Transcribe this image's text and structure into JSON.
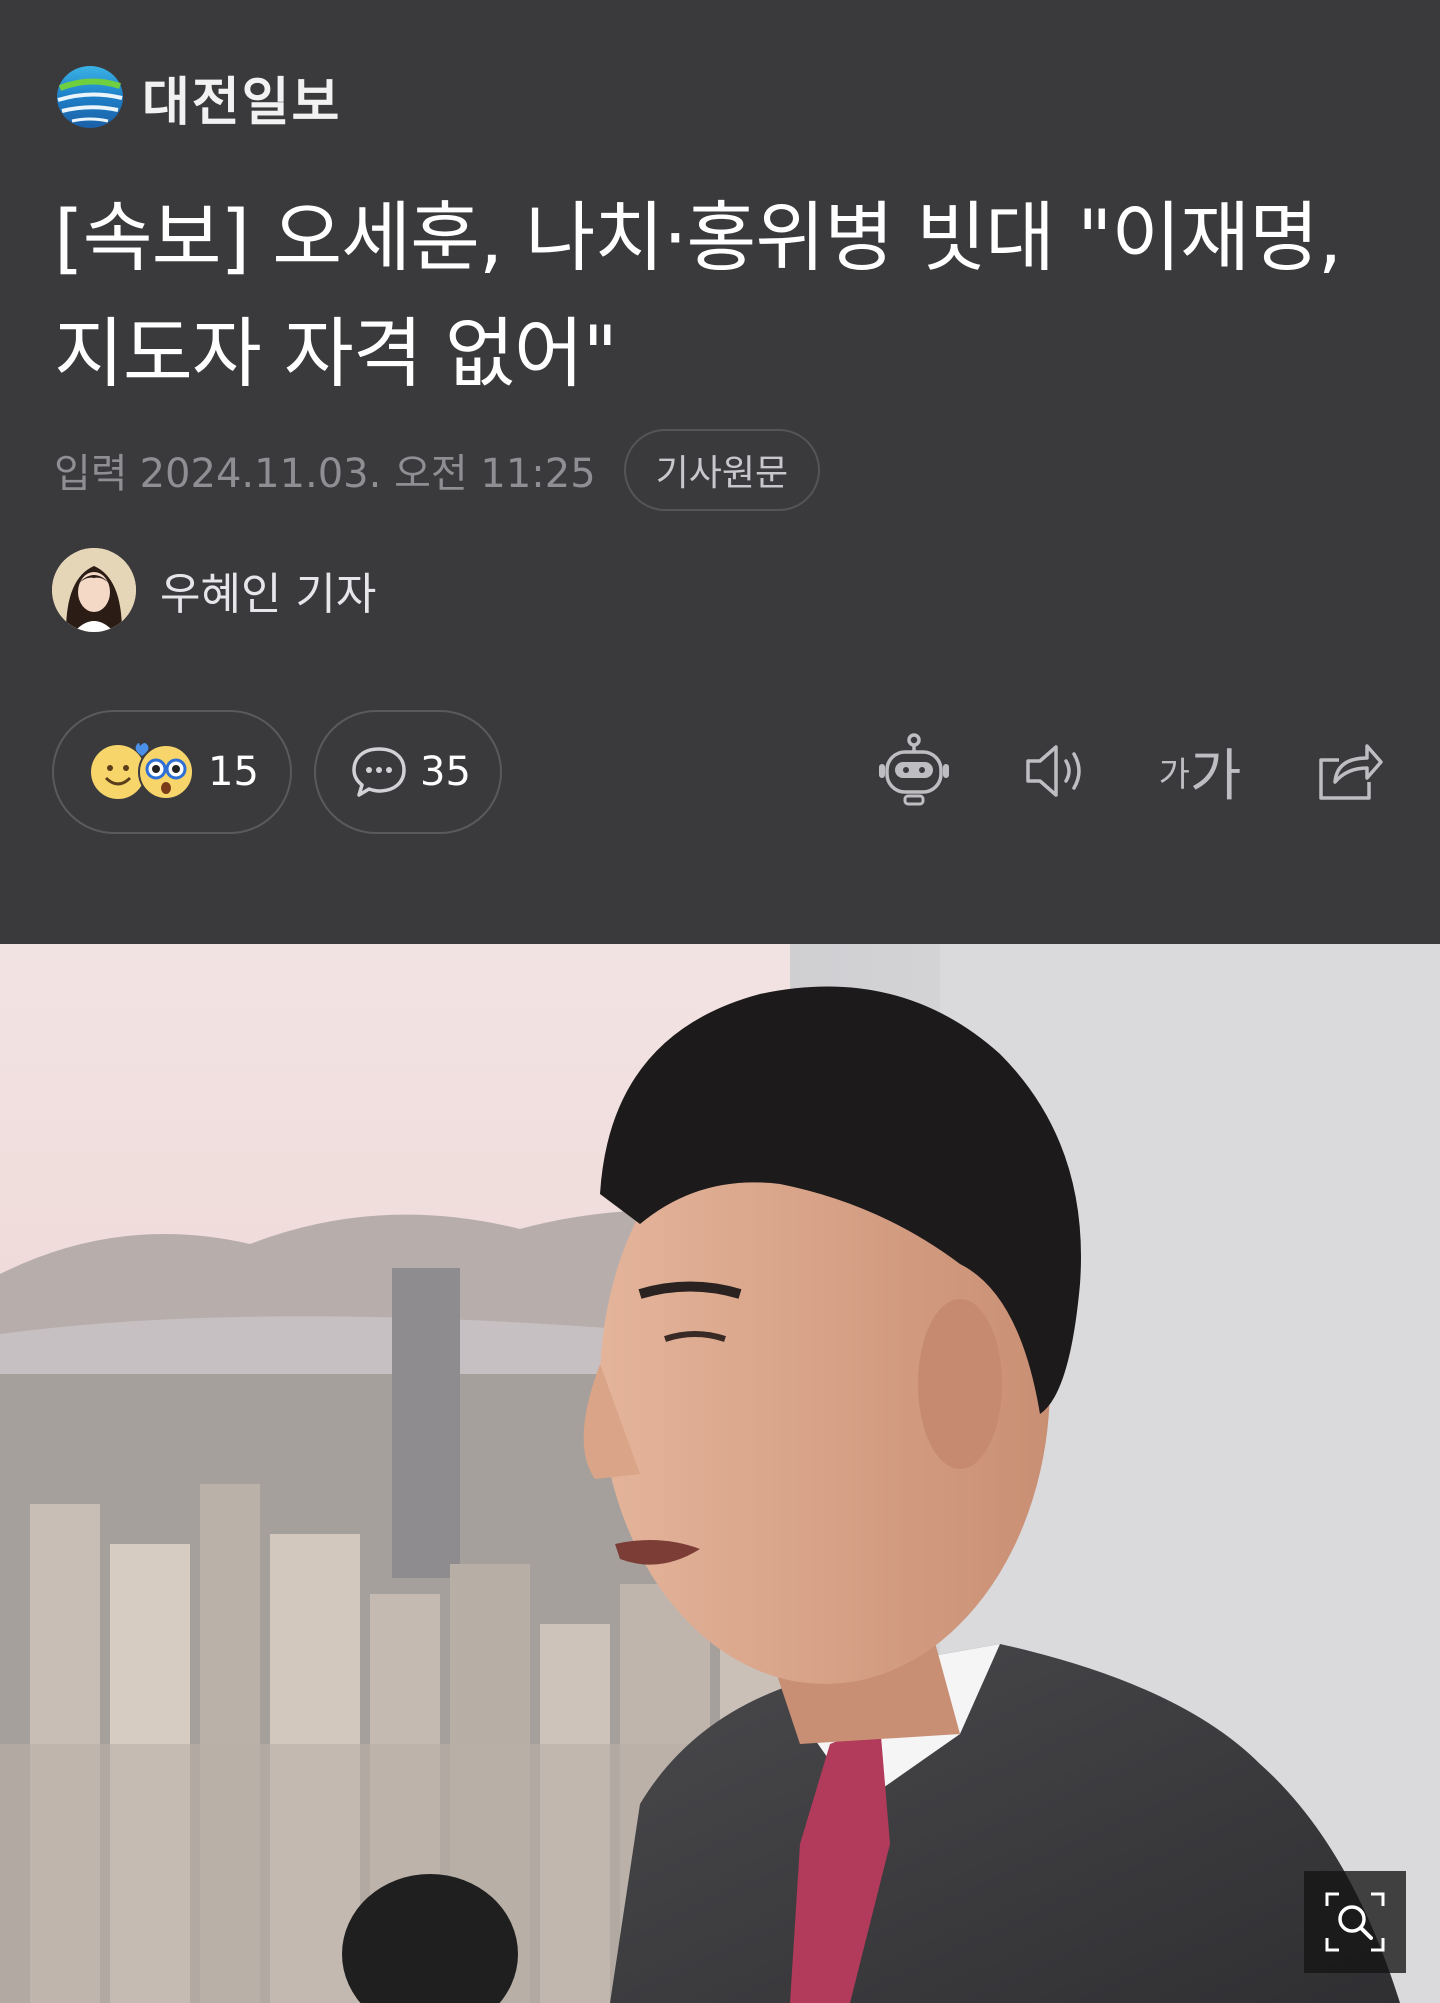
{
  "publisher": {
    "name": "대전일보"
  },
  "article": {
    "headline": "[속보] 오세훈, 나치·홍위병 빗대 \"이재명, 지도자 자격 없어\"",
    "date_label": "입력",
    "date": "2024.11.03. 오전 11:25",
    "original_link_label": "기사원문",
    "reporter": "우혜인 기자"
  },
  "reactions": {
    "count": "15",
    "icons": [
      "smile-emoji-icon",
      "surprised-emoji-icon"
    ]
  },
  "comments": {
    "count": "35",
    "icon": "speech-bubble-icon"
  },
  "toolbar": {
    "items": [
      "robot-summary-icon",
      "speaker-icon",
      "font-size-icon",
      "share-icon"
    ],
    "font_label_small": "가",
    "font_label_large": "가"
  },
  "photo": {
    "zoom_icon": "zoom-search-icon"
  },
  "colors": {
    "background": "#3a3a3c",
    "text_primary": "#ffffff",
    "text_secondary": "#8e8e93"
  }
}
